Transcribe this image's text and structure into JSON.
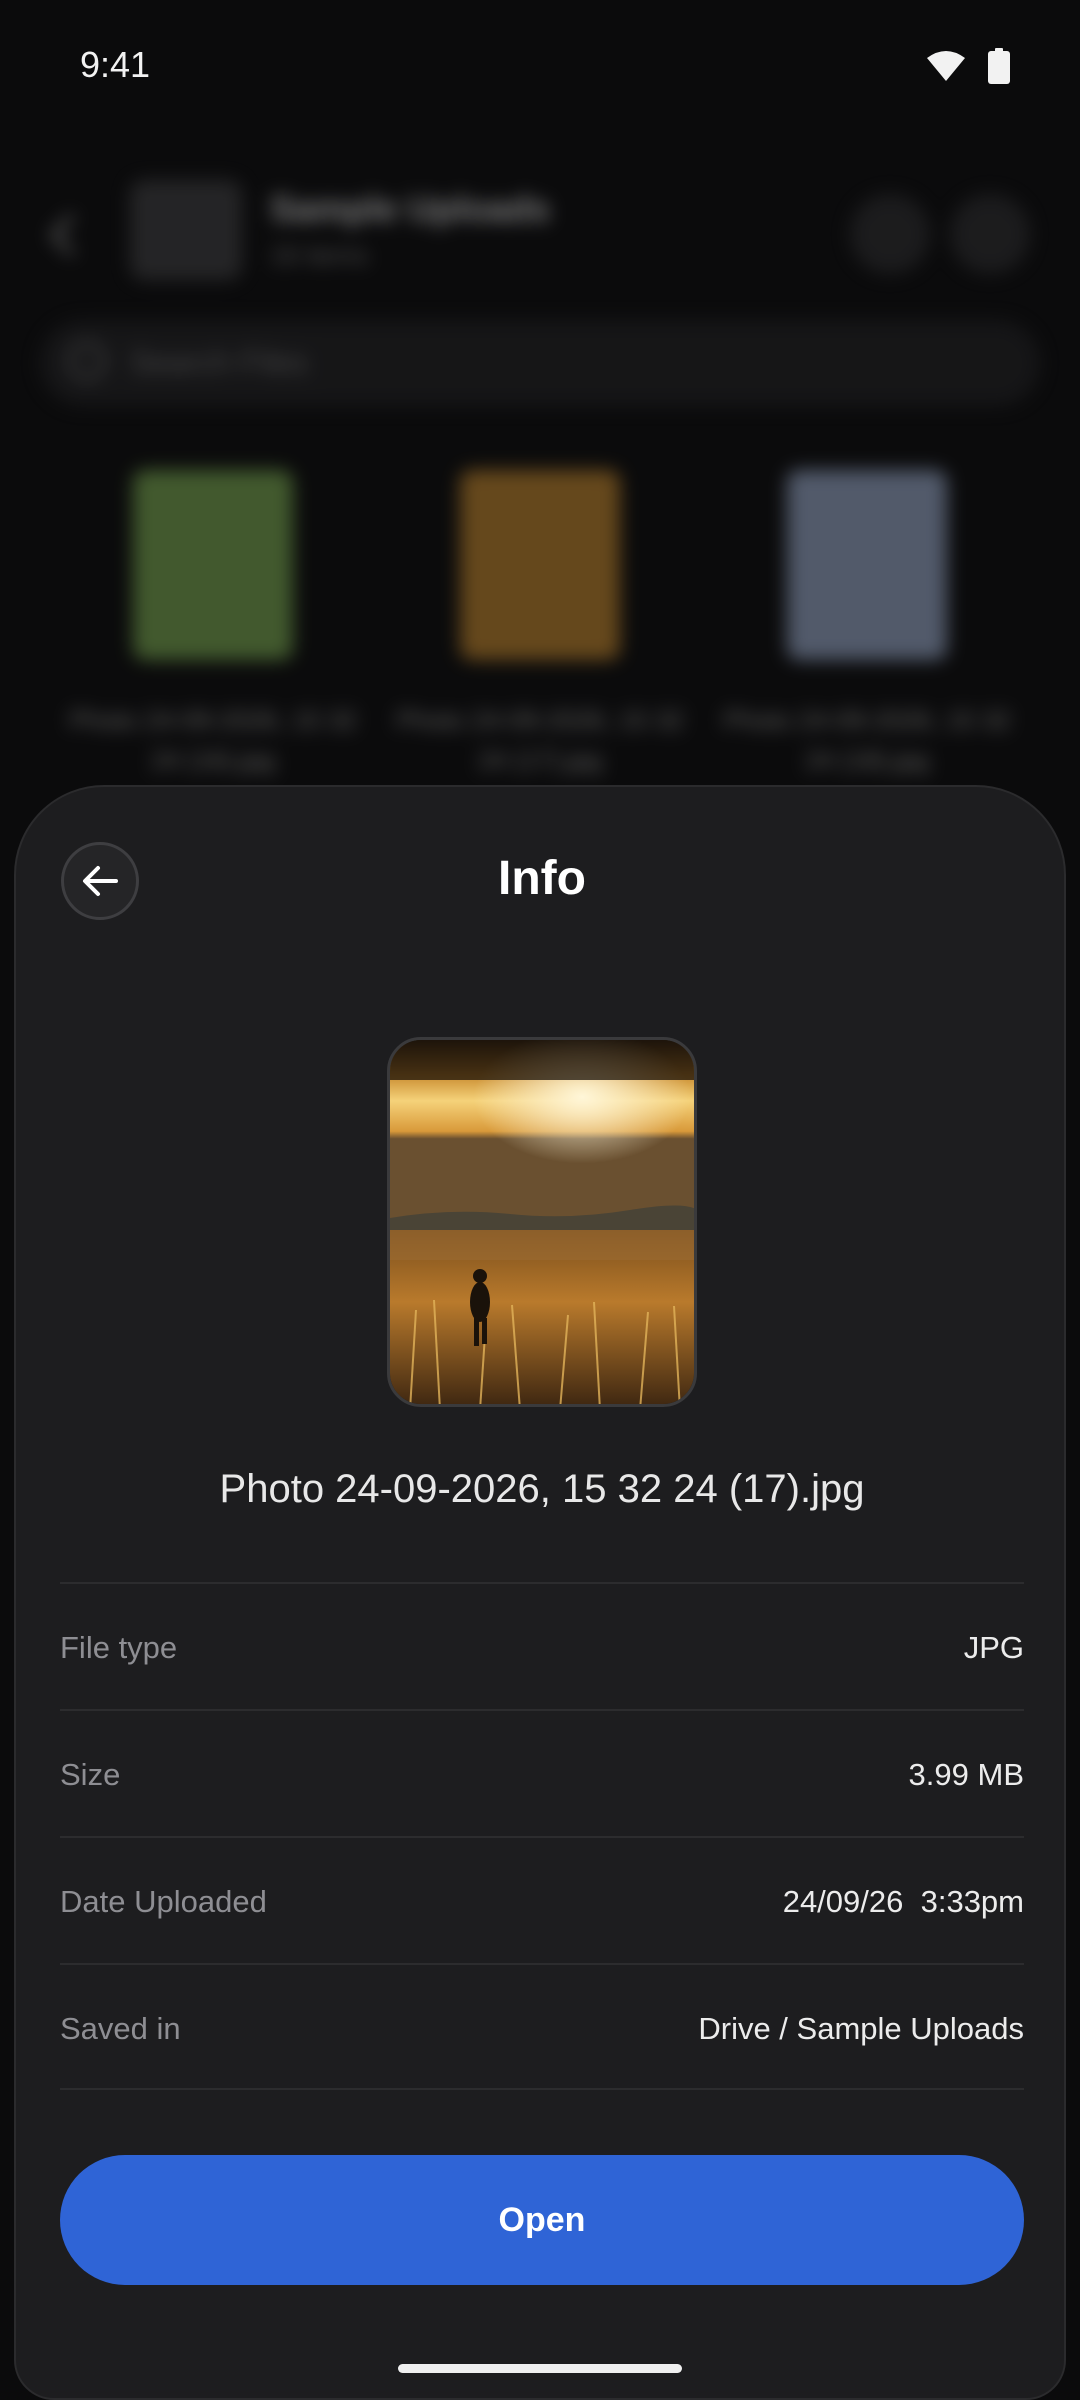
{
  "status_bar": {
    "time": "9:41",
    "icons": [
      "wifi-icon",
      "battery-icon"
    ]
  },
  "background": {
    "title": "Sample Uploads",
    "subtitle": "16 items",
    "search_placeholder": "Search Files",
    "thumbnails": [
      {
        "label": "Photo 24-09-2026, 15 32 24 (16).jpg",
        "color": "#6f9a4a"
      },
      {
        "label": "Photo 24-09-2026, 15 32 24 (17).jpg",
        "color": "#b07a2a"
      },
      {
        "label": "Photo 24-09-2026, 15 32 24 (18).jpg",
        "color": "#8c9bb8"
      }
    ]
  },
  "sheet": {
    "title": "Info",
    "back_icon": "arrow-left-icon",
    "file_name": "Photo 24-09-2026, 15 32 24 (17).jpg",
    "rows": [
      {
        "label": "File type",
        "value": "JPG"
      },
      {
        "label": "Size",
        "value": "3.99 MB"
      },
      {
        "label": "Date Uploaded",
        "value": "24/09/26  3:33pm"
      },
      {
        "label": "Saved in",
        "value": "Drive / Sample Uploads"
      }
    ],
    "open_label": "Open"
  },
  "colors": {
    "accent": "#2f64d6",
    "sheet_bg": "#1d1d1f",
    "label_gray": "#8e8e93"
  }
}
